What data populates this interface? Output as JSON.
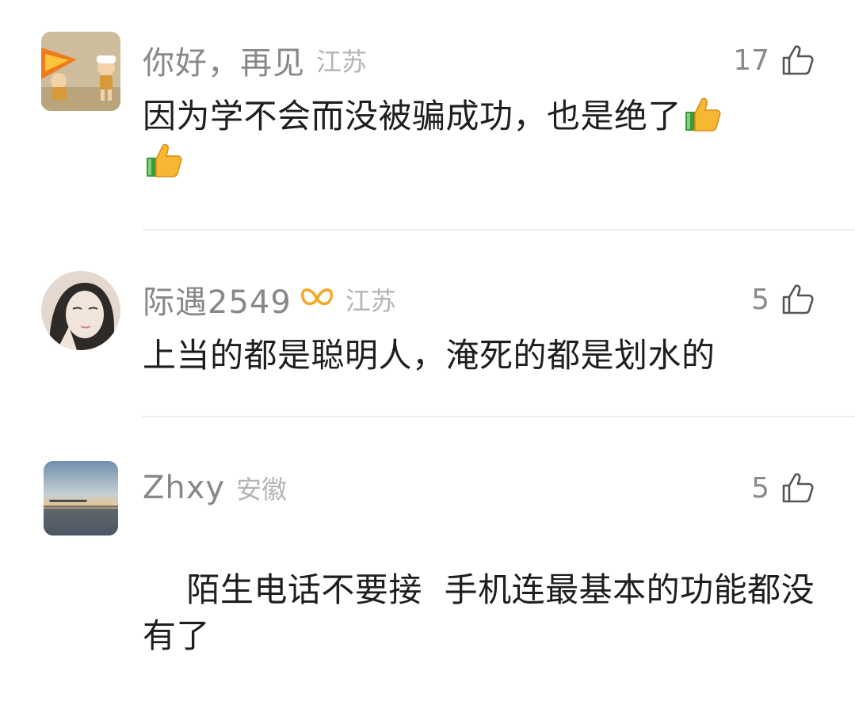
{
  "comments": [
    {
      "username": "你好，再见",
      "location": "江苏",
      "likes": "17",
      "text": "因为学不会而没被骗成功，也是绝了",
      "emoji_count": 2,
      "avatar_icon": "cartoon-caveman-avatar"
    },
    {
      "username": "际遇2549",
      "location": "江苏",
      "likes": "5",
      "text": "上当的都是聪明人，淹死的都是划水的",
      "vip_icon": "vip-badge-icon",
      "avatar_icon": "sketch-portrait-avatar"
    },
    {
      "username": "Zhxy",
      "location": "安徽",
      "likes": "5",
      "text": "陌生电话不要接  手机连最基本的功能都没有了",
      "avatar_icon": "sunset-lake-avatar"
    }
  ],
  "colors": {
    "username": "#888888",
    "location": "#b4b4b4",
    "text": "#1e1e1e",
    "vip": "#f5a623",
    "divider": "#ececec"
  }
}
